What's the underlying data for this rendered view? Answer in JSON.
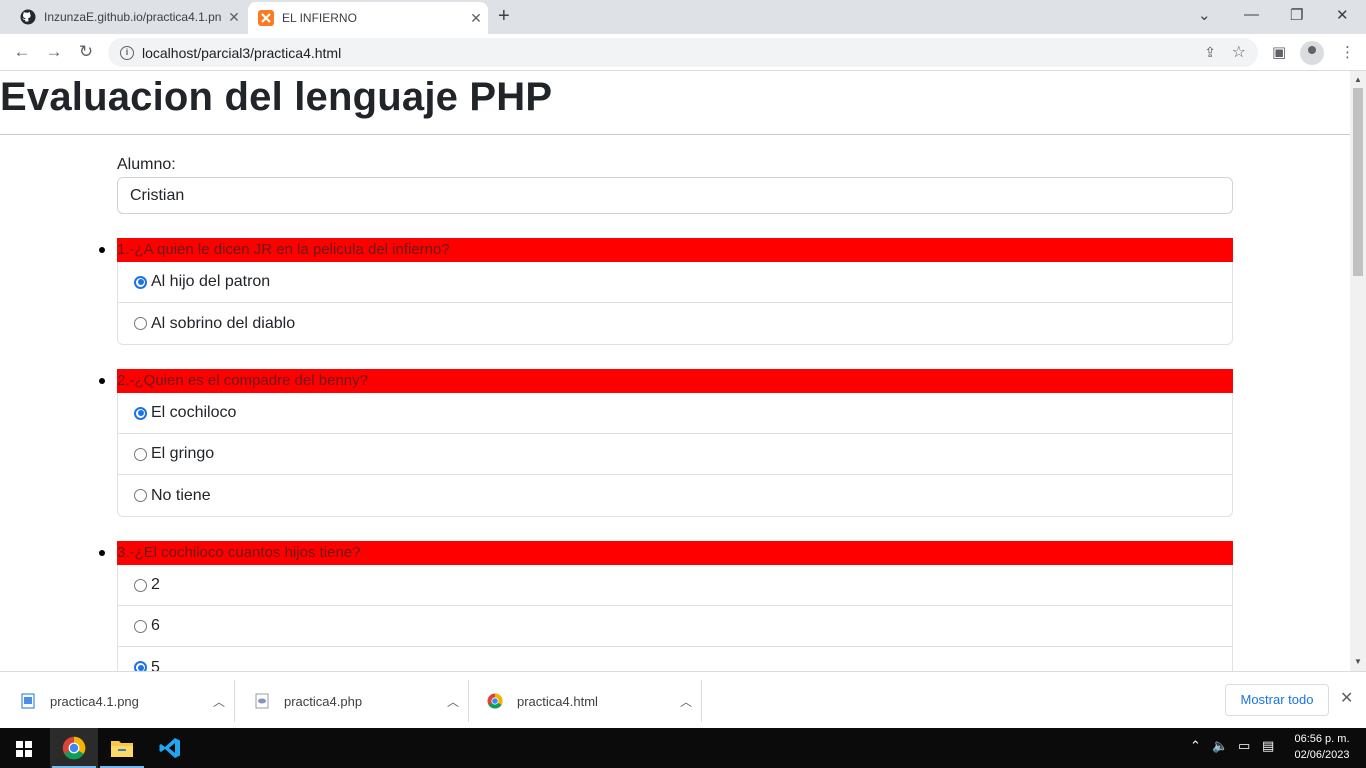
{
  "browser": {
    "tabs": [
      {
        "title": "InzunzaE.github.io/practica4.1.pn",
        "icon": "github-icon",
        "active": false
      },
      {
        "title": "EL INFIERNO",
        "icon": "xampp-icon",
        "active": true
      }
    ],
    "url": "localhost/parcial3/practica4.html"
  },
  "page": {
    "title": "Evaluacion del lenguaje PHP",
    "alumno_label": "Alumno:",
    "alumno_value": "Cristian",
    "questions": [
      {
        "text": "1.-¿A quien le dicen JR en la pelicula del infierno?",
        "options": [
          {
            "label": "Al hijo del patron",
            "checked": true
          },
          {
            "label": "Al sobrino del diablo",
            "checked": false
          }
        ]
      },
      {
        "text": "2.-¿Quien es el compadre del benny?",
        "options": [
          {
            "label": "El cochiloco",
            "checked": true
          },
          {
            "label": "El gringo",
            "checked": false
          },
          {
            "label": "No tiene",
            "checked": false
          }
        ]
      },
      {
        "text": "3.-¿El cochiloco cuantos hijos tiene?",
        "options": [
          {
            "label": "2",
            "checked": false
          },
          {
            "label": "6",
            "checked": false
          },
          {
            "label": "5",
            "checked": true
          }
        ]
      }
    ]
  },
  "downloads": {
    "items": [
      {
        "name": "practica4.1.png",
        "icon": "image-file-icon"
      },
      {
        "name": "practica4.php",
        "icon": "php-file-icon"
      },
      {
        "name": "practica4.html",
        "icon": "chrome-icon"
      }
    ],
    "show_all": "Mostrar todo"
  },
  "taskbar": {
    "time": "06:56 p. m.",
    "date": "02/06/2023"
  },
  "colors": {
    "question_bg": "#ff0000",
    "radio_checked": "#1a73e8"
  }
}
